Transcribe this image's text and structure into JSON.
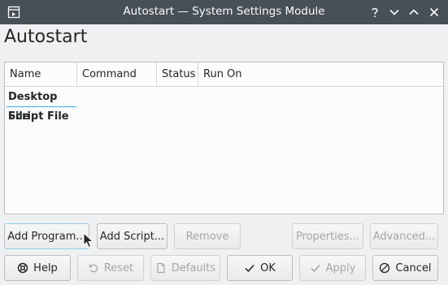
{
  "window": {
    "title": "Autostart — System Settings Module"
  },
  "page": {
    "title": "Autostart"
  },
  "list": {
    "columns": [
      "Name",
      "Command",
      "Status",
      "Run On"
    ],
    "groups": [
      "Desktop File",
      "Script File"
    ]
  },
  "actions": {
    "add_program": "Add Program...",
    "add_script": "Add Script...",
    "remove": "Remove",
    "properties": "Properties...",
    "advanced": "Advanced..."
  },
  "dialog": {
    "help": "Help",
    "reset": "Reset",
    "defaults": "Defaults",
    "ok": "OK",
    "apply": "Apply",
    "cancel": "Cancel"
  },
  "colors": {
    "titlebar": "#475057",
    "selection": "#3daee9"
  }
}
